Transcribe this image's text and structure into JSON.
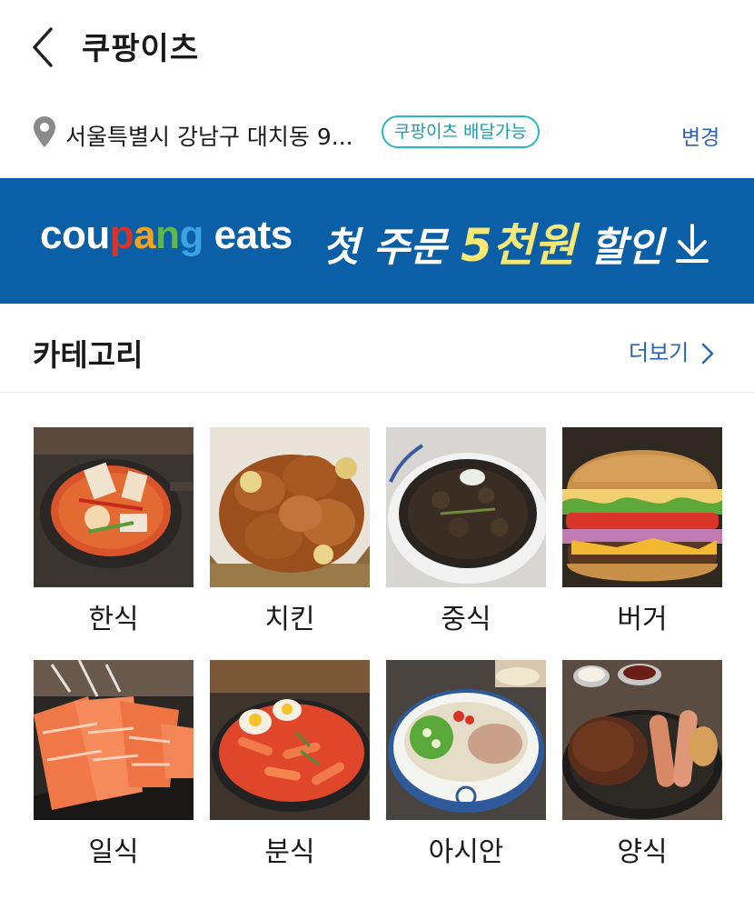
{
  "header": {
    "title": "쿠팡이츠"
  },
  "address": {
    "text": "서울특별시 강남구 대치동 9...",
    "badge": "쿠팡이츠 배달가능",
    "change_label": "변경"
  },
  "banner": {
    "brand_letters": [
      "c",
      "o",
      "u",
      "p",
      "a",
      "n",
      "g",
      " ",
      "e",
      "a",
      "t",
      "s"
    ],
    "promo_prefix": "첫 주문 ",
    "promo_highlight": "5천원",
    "promo_suffix": " 할인",
    "colors": {
      "background": "#0b5fa6",
      "highlight": "#f7e774"
    }
  },
  "category_section": {
    "title": "카테고리",
    "more_label": "더보기"
  },
  "categories": [
    {
      "label": "한식",
      "icon": "korean-food-image"
    },
    {
      "label": "치킨",
      "icon": "chicken-image"
    },
    {
      "label": "중식",
      "icon": "chinese-food-image"
    },
    {
      "label": "버거",
      "icon": "burger-image"
    },
    {
      "label": "일식",
      "icon": "japanese-food-image"
    },
    {
      "label": "분식",
      "icon": "snack-food-image"
    },
    {
      "label": "아시안",
      "icon": "asian-food-image"
    },
    {
      "label": "양식",
      "icon": "western-food-image"
    }
  ]
}
